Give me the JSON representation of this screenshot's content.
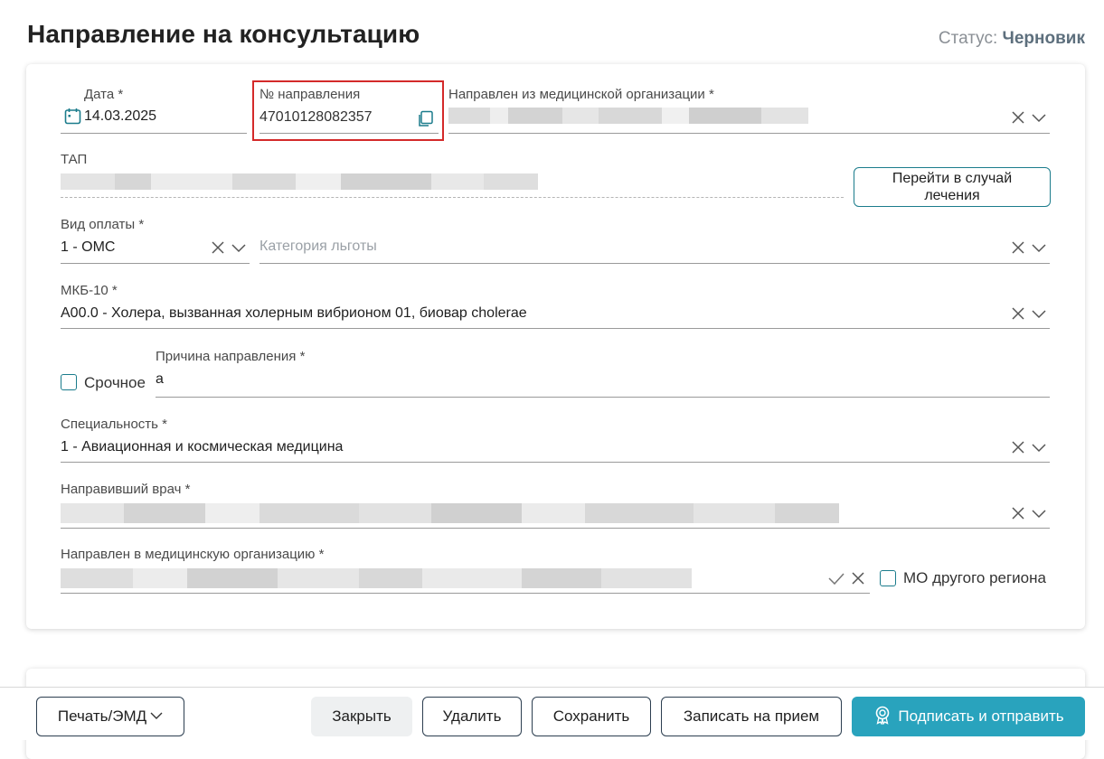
{
  "header": {
    "title": "Направление на консультацию",
    "status_label": "Статус:",
    "status_value": "Черновик"
  },
  "form": {
    "date": {
      "label": "Дата *",
      "value": "14.03.2025"
    },
    "referral_number": {
      "label": "№ направления",
      "value": "47010128082357"
    },
    "from_org": {
      "label": "Направлен из медицинской организации *"
    },
    "tap": {
      "label": "ТАП"
    },
    "go_to_case_button": "Перейти в случай лечения",
    "payment_type": {
      "label": "Вид оплаты *",
      "value": "1 - ОМС"
    },
    "benefit_category": {
      "placeholder": "Категория льготы"
    },
    "mkb10": {
      "label": "МКБ-10 *",
      "value": "A00.0 - Холера, вызванная холерным вибрионом 01, биовар cholerae"
    },
    "urgent": {
      "label": "Срочное",
      "checked": false
    },
    "reason": {
      "label": "Причина направления *",
      "value": "а"
    },
    "specialty": {
      "label": "Специальность *",
      "value": "1 - Авиационная и космическая медицина"
    },
    "doctor": {
      "label": "Направивший врач *"
    },
    "to_org": {
      "label": "Направлен в медицинскую организацию *"
    },
    "other_region": {
      "label": "МО другого региона",
      "checked": false
    }
  },
  "footer": {
    "print_button": "Печать/ЭМД",
    "close_button": "Закрыть",
    "delete_button": "Удалить",
    "save_button": "Сохранить",
    "appointment_button": "Записать на прием",
    "sign_send_button": "Подписать и отправить"
  },
  "colors": {
    "accent": "#1b7c8c",
    "primary_button": "#29a3bd",
    "highlight_border": "#d42a2a",
    "status_value": "#5d6f7d"
  },
  "icons": [
    "calendar-icon",
    "copy-icon",
    "clear-icon",
    "chevron-down-icon",
    "check-icon",
    "certificate-icon"
  ]
}
